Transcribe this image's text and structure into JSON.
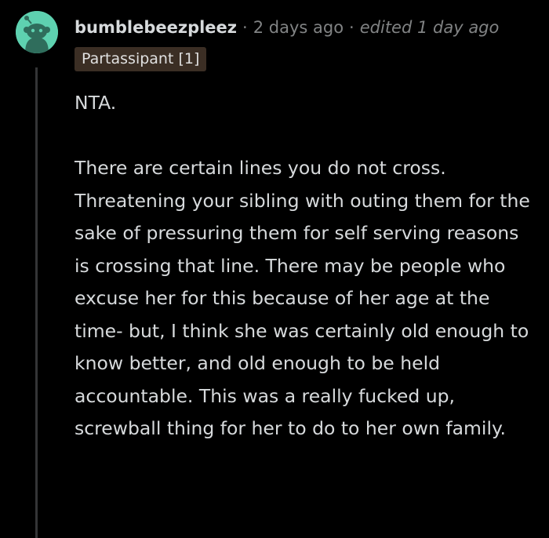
{
  "comment": {
    "author": "bumblebeezpleez",
    "separator": "·",
    "posted": "2 days ago",
    "edited": "edited 1 day ago",
    "flair": "Partassipant [1]",
    "body": {
      "line1": "NTA.",
      "paragraph": "There are certain lines you do not cross. Threatening your sibling with outing them for the sake of pressuring them for self serving reasons is crossing that line. There may be people who excuse her for this because of her age at the time- but, I think she was certainly old enough to know better, and old enough to be held accountable. This was a really fucked up, screwball thing for her to do to her own family."
    },
    "avatar_icon": "snoo-avatar-icon"
  },
  "colors": {
    "background": "#000000",
    "text": "#d7dadc",
    "muted": "#818384",
    "avatar_bg": "#5ed1b0",
    "flair_bg": "#3b2e24",
    "thread_line": "#343536"
  }
}
